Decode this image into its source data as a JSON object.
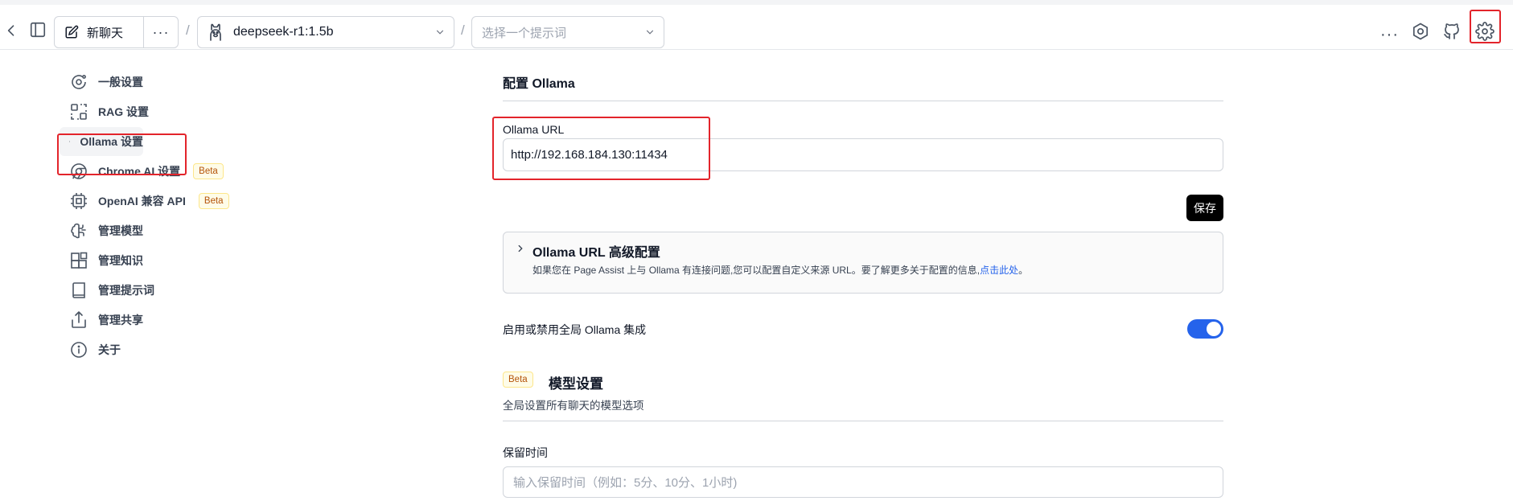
{
  "topbar": {
    "new_chat_label": "新聊天",
    "more_label": "···",
    "separator": "/",
    "model_selected": "deepseek-r1:1.5b",
    "prompt_placeholder": "选择一个提示词",
    "right_more_label": "···",
    "icons": [
      "back-icon",
      "sidebar-toggle-icon",
      "edit-icon",
      "llama-icon",
      "chevron-down-icon",
      "settings-icon",
      "github-icon",
      "gear-icon"
    ]
  },
  "sidebar": {
    "items": [
      {
        "label": "一般设置",
        "icon": "general-settings-icon"
      },
      {
        "label": "RAG 设置",
        "icon": "rag-icon"
      },
      {
        "label": "Ollama 设置",
        "icon": "llama-icon",
        "active": true
      },
      {
        "label": "Chrome AI 设置",
        "icon": "chrome-icon",
        "badge": "Beta"
      },
      {
        "label": "OpenAI 兼容 API",
        "icon": "chip-icon",
        "badge": "Beta"
      },
      {
        "label": "管理模型",
        "icon": "brain-icon"
      },
      {
        "label": "管理知识",
        "icon": "blocks-icon"
      },
      {
        "label": "管理提示词",
        "icon": "book-icon"
      },
      {
        "label": "管理共享",
        "icon": "share-icon"
      },
      {
        "label": "关于",
        "icon": "info-icon"
      }
    ]
  },
  "main": {
    "section_title": "配置 Ollama",
    "url_label": "Ollama URL",
    "url_value": "http://192.168.184.130:11434",
    "save_label": "保存",
    "advanced": {
      "title": "Ollama URL 高级配置",
      "desc": "如果您在 Page Assist 上与 Ollama 有连接问题,您可以配置自定义来源 URL。要了解更多关于配置的信息,",
      "link": "点击此处",
      "desc_end": "。"
    },
    "toggle_label": "启用或禁用全局 Ollama 集成",
    "toggle_on": true,
    "model_settings": {
      "badge": "Beta",
      "title": "模型设置",
      "desc": "全局设置所有聊天的模型选项"
    },
    "keep_alive": {
      "label": "保留时间",
      "placeholder": "输入保留时间（例如：5分、10分、1小时)"
    }
  },
  "colors": {
    "accent": "#2563eb",
    "highlight": "#e3242b",
    "beta_bg": "#fefce8",
    "beta_text": "#b45309"
  }
}
